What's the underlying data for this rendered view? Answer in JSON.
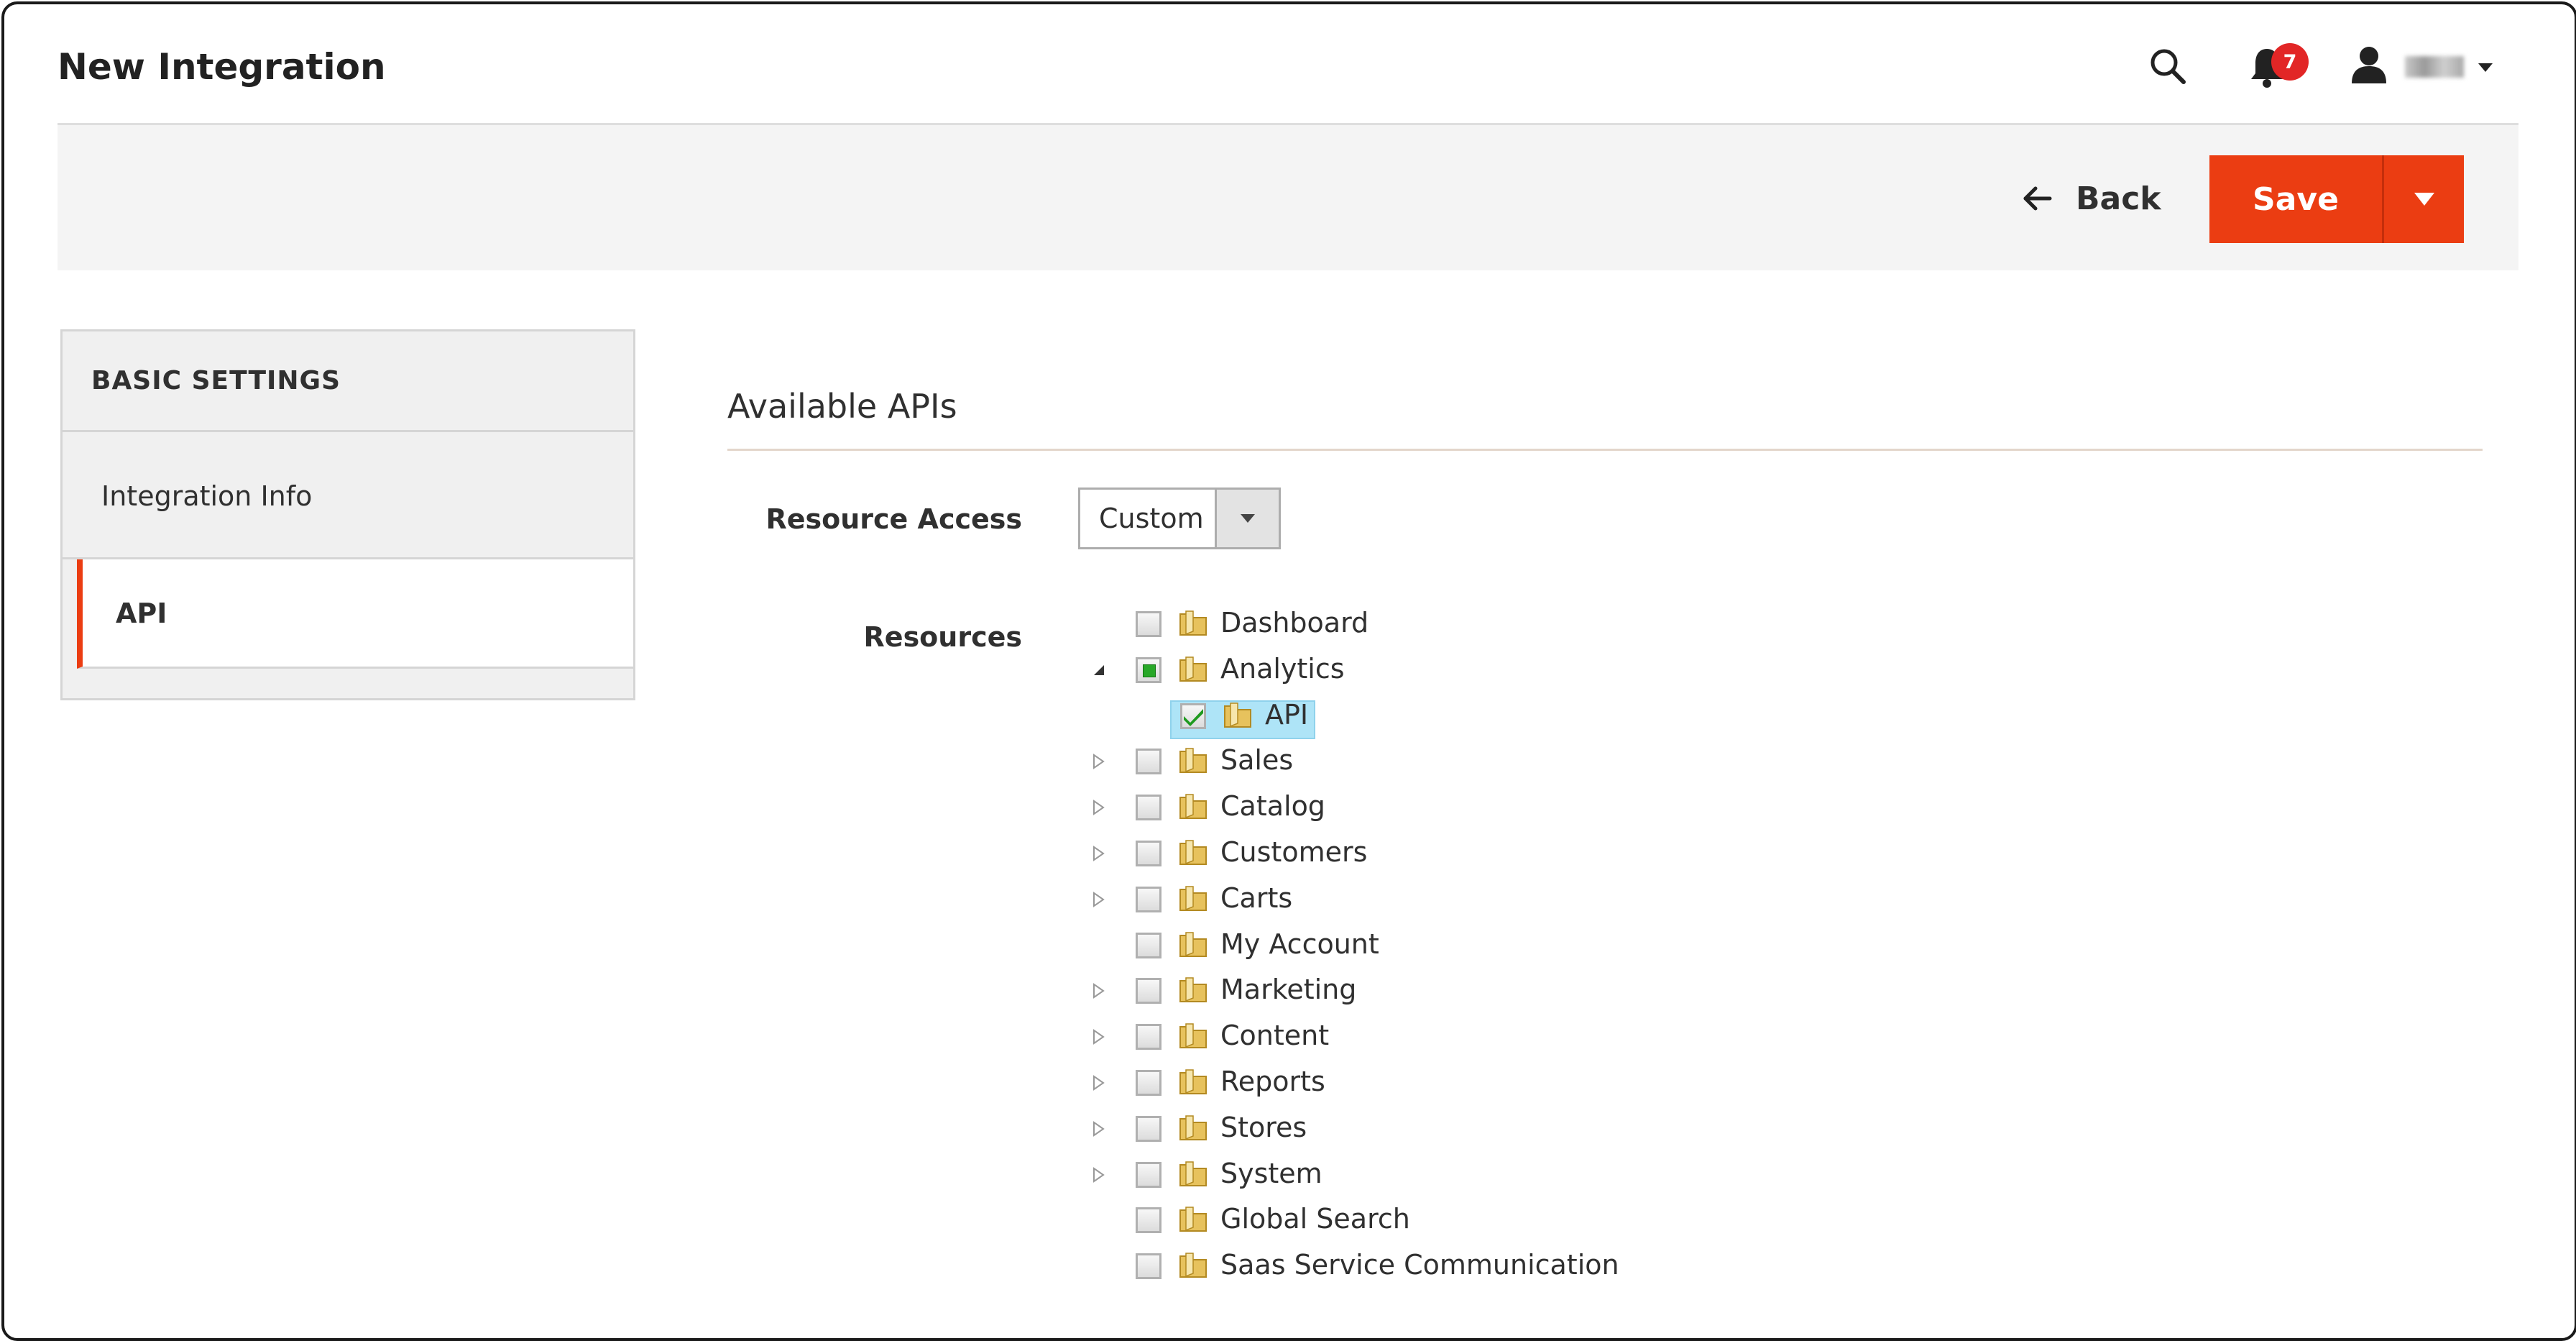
{
  "page": {
    "title": "New Integration"
  },
  "header": {
    "notifications_count": "7",
    "icons": [
      "search-icon",
      "bell-icon",
      "user-icon",
      "caret-down-icon"
    ]
  },
  "actions": {
    "back_label": "Back",
    "save_label": "Save"
  },
  "sidebar": {
    "title": "BASIC SETTINGS",
    "items": [
      {
        "label": "Integration Info",
        "active": false
      },
      {
        "label": "API",
        "active": true
      }
    ]
  },
  "main": {
    "section_title": "Available APIs",
    "resource_access_label": "Resource Access",
    "resource_access_value": "Custom",
    "resources_label": "Resources"
  },
  "tree": {
    "items": [
      {
        "label": "Dashboard",
        "expander": "none",
        "state": "unchecked"
      },
      {
        "label": "Analytics",
        "expander": "expanded",
        "state": "partial"
      },
      {
        "label": "API",
        "expander": "none",
        "state": "checked",
        "child": true,
        "selected": true
      },
      {
        "label": "Sales",
        "expander": "collapsed",
        "state": "unchecked"
      },
      {
        "label": "Catalog",
        "expander": "collapsed",
        "state": "unchecked"
      },
      {
        "label": "Customers",
        "expander": "collapsed",
        "state": "unchecked"
      },
      {
        "label": "Carts",
        "expander": "collapsed",
        "state": "unchecked"
      },
      {
        "label": "My Account",
        "expander": "none",
        "state": "unchecked"
      },
      {
        "label": "Marketing",
        "expander": "collapsed",
        "state": "unchecked"
      },
      {
        "label": "Content",
        "expander": "collapsed",
        "state": "unchecked"
      },
      {
        "label": "Reports",
        "expander": "collapsed",
        "state": "unchecked"
      },
      {
        "label": "Stores",
        "expander": "collapsed",
        "state": "unchecked"
      },
      {
        "label": "System",
        "expander": "collapsed",
        "state": "unchecked"
      },
      {
        "label": "Global Search",
        "expander": "none",
        "state": "unchecked"
      },
      {
        "label": "Saas Service Communication",
        "expander": "none",
        "state": "unchecked"
      }
    ]
  },
  "colors": {
    "accent": "#eb3d12",
    "selection": "#aee4f7",
    "check": "#28a828"
  }
}
